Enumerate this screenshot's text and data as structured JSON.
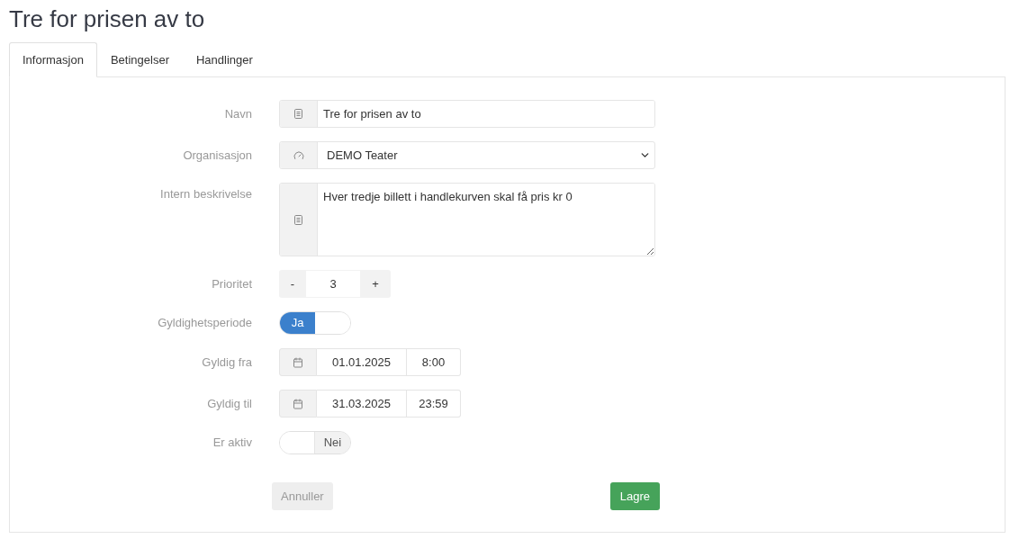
{
  "title": "Tre for prisen av to",
  "tabs": [
    {
      "label": "Informasjon",
      "selected": true
    },
    {
      "label": "Betingelser",
      "selected": false
    },
    {
      "label": "Handlinger",
      "selected": false
    }
  ],
  "form": {
    "fields": [
      {
        "kind": "text",
        "label": "Navn",
        "value": "Tre for prisen av to"
      },
      {
        "kind": "select",
        "label": "Organisasjon",
        "value": "DEMO Teater"
      },
      {
        "kind": "textarea",
        "label": "Intern beskrivelse",
        "value": "Hver tredje billett i handlekurven skal få pris kr 0"
      },
      {
        "kind": "stepper",
        "label": "Prioritet",
        "decrement": "-",
        "value": "3",
        "increment": "+"
      },
      {
        "kind": "toggle",
        "label": "Gyldighetsperiode",
        "on": true,
        "text": "Ja"
      },
      {
        "kind": "datetime",
        "label": "Gyldig fra",
        "date": "01.01.2025",
        "time": "8:00"
      },
      {
        "kind": "datetime",
        "label": "Gyldig til",
        "date": "31.03.2025",
        "time": "23:59"
      },
      {
        "kind": "toggle",
        "label": "Er aktiv",
        "on": false,
        "text": "Nei"
      }
    ]
  },
  "buttons": [
    {
      "kind": "cancel",
      "label": "Annuller"
    },
    {
      "kind": "save",
      "label": "Lagre"
    }
  ]
}
